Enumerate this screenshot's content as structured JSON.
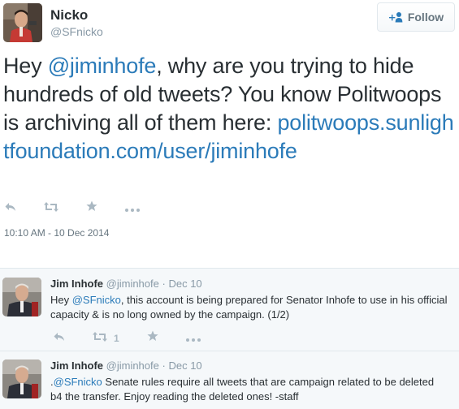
{
  "main_tweet": {
    "author_name": "Nicko",
    "author_handle": "@SFnicko",
    "follow_label": "Follow",
    "text_prefix": "Hey ",
    "mention": "@jiminhofe",
    "text_middle": ", why are you trying to hide hundreds of old tweets? You know Politwoops is archiving all of them here: ",
    "link": "politwoops.sunlightfoundation.com/user/jiminhofe",
    "timestamp": "10:10 AM - 10 Dec 2014",
    "actions": {
      "reply_icon": "reply-icon",
      "retweet_icon": "retweet-icon",
      "favorite_icon": "star-icon",
      "more_icon": "more-dots-icon"
    }
  },
  "replies": [
    {
      "author_name": "Jim Inhofe",
      "author_handle": "@jiminhofe",
      "separator": "·",
      "date": "Dec 10",
      "text_prefix": "Hey ",
      "mention": "@SFnicko",
      "text_rest": ", this account is being prepared for Senator Inhofe to use in his official capacity & is no long owned by the campaign. (1/2)",
      "retweet_count": "1"
    },
    {
      "author_name": "Jim Inhofe",
      "author_handle": "@jiminhofe",
      "separator": "·",
      "date": "Dec 10",
      "text_prefix": ".",
      "mention": "@SFnicko",
      "text_rest": " Senate rules require all tweets that are campaign related to be deleted b4 the transfer. Enjoy reading the deleted ones! -staff"
    }
  ],
  "colors": {
    "link": "#2b7bb9",
    "text": "#292f33",
    "muted": "#8899a6",
    "icon": "#aab8c2",
    "reply_bg": "#f5f8fa"
  }
}
